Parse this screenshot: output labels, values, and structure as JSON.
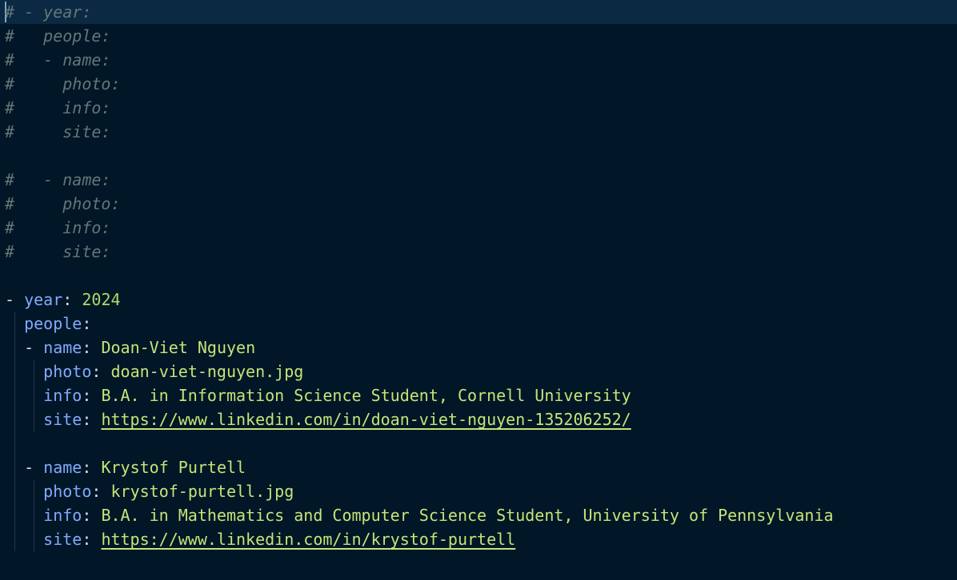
{
  "editor": {
    "colors": {
      "background": "#011627",
      "active_line": "#0b2942",
      "comment": "#637777",
      "key": "#82aaff",
      "string": "#c5e478",
      "number": "#addb67"
    },
    "comment_block": {
      "lines": [
        "# - year:",
        "#   people:",
        "#   - name:",
        "#     photo:",
        "#     info:",
        "#     site:",
        "",
        "#   - name:",
        "#     photo:",
        "#     info:",
        "#     site:"
      ]
    },
    "entry": {
      "dash": "-",
      "year_key": "year",
      "year_value": "2024",
      "people_key": "people",
      "people": [
        {
          "name_key": "name",
          "name": "Doan-Viet Nguyen",
          "photo_key": "photo",
          "photo": "doan-viet-nguyen.jpg",
          "info_key": "info",
          "info": "B.A. in Information Science Student, Cornell University",
          "site_key": "site",
          "site": "https://www.linkedin.com/in/doan-viet-nguyen-135206252/"
        },
        {
          "name_key": "name",
          "name": "Krystof Purtell",
          "photo_key": "photo",
          "photo": "krystof-purtell.jpg",
          "info_key": "info",
          "info": "B.A. in Mathematics and Computer Science Student, University of Pennsylvania",
          "site_key": "site",
          "site": "https://www.linkedin.com/in/krystof-purtell"
        }
      ]
    }
  }
}
